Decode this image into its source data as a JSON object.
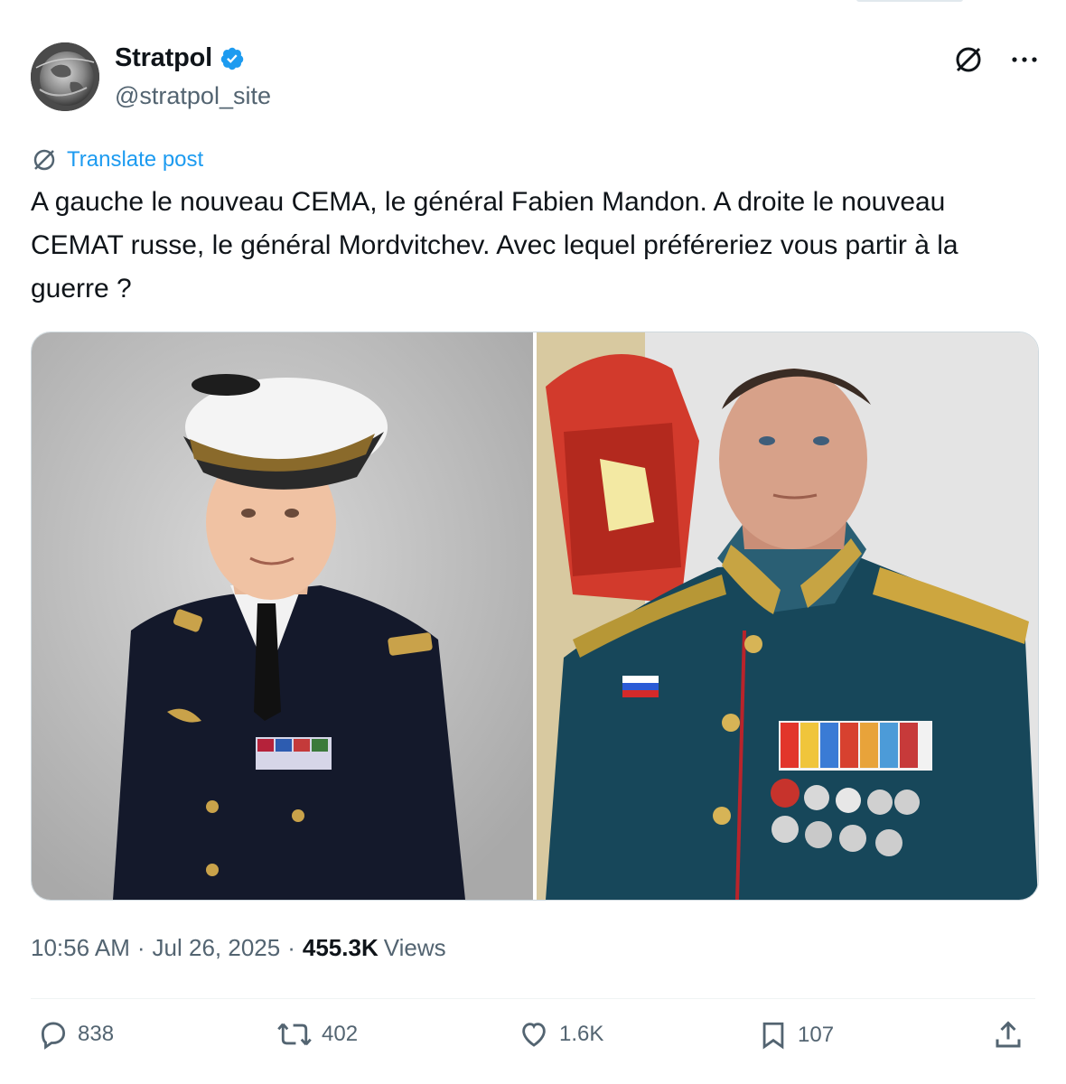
{
  "post": {
    "author": {
      "display_name": "Stratpol",
      "handle": "@stratpol_site",
      "verified": true
    },
    "translate_label": "Translate post",
    "text": "A gauche le nouveau CEMA, le général Fabien Mandon. A droite le nouveau CEMAT russe, le général Mordvitchev. Avec lequel préféreriez vous partir à la guerre ?",
    "meta": {
      "time": "10:56 AM",
      "separator": "·",
      "date": "Jul 26, 2025",
      "views_count": "455.3K",
      "views_label": "Views"
    },
    "actions": {
      "replies": "838",
      "reposts": "402",
      "likes": "1.6K",
      "bookmarks": "107"
    },
    "media": {
      "left_photo": "photo-french-general",
      "right_photo": "photo-russian-general"
    }
  },
  "colors": {
    "link": "#1d9bf0",
    "secondary_text": "#536471",
    "primary_text": "#0f1419",
    "verified": "#1d9bf0"
  },
  "icons": [
    "translate-icon",
    "more-icon",
    "reply-icon",
    "repost-icon",
    "like-icon",
    "bookmark-icon",
    "share-icon",
    "verified-badge-icon"
  ]
}
